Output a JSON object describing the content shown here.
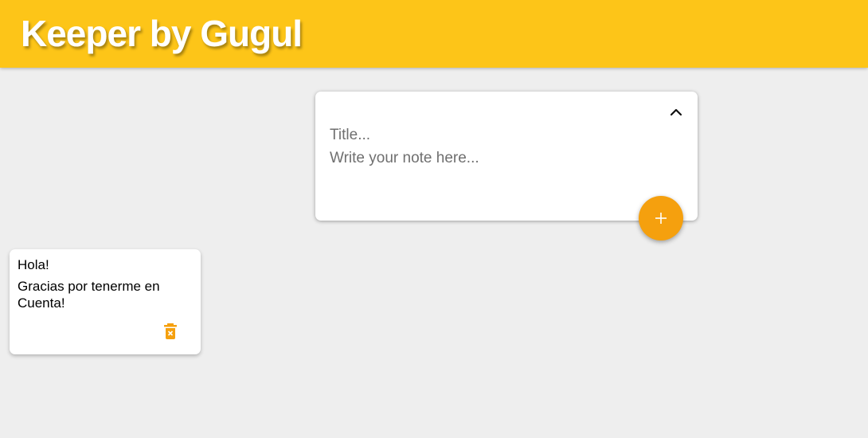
{
  "header": {
    "title": "Keeper by Gugul"
  },
  "create_note": {
    "title_placeholder": "Title...",
    "content_placeholder": "Write your note here...",
    "collapse_icon": "chevron-up-icon",
    "add_icon": "plus-icon"
  },
  "notes": [
    {
      "title": "Hola!",
      "content": "Gracias por tenerme en Cuenta!",
      "delete_icon": "trash-icon"
    }
  ],
  "colors": {
    "header_bg": "#fdc518",
    "accent": "#f5a00e",
    "background": "#eeeeee",
    "card": "#ffffff"
  }
}
